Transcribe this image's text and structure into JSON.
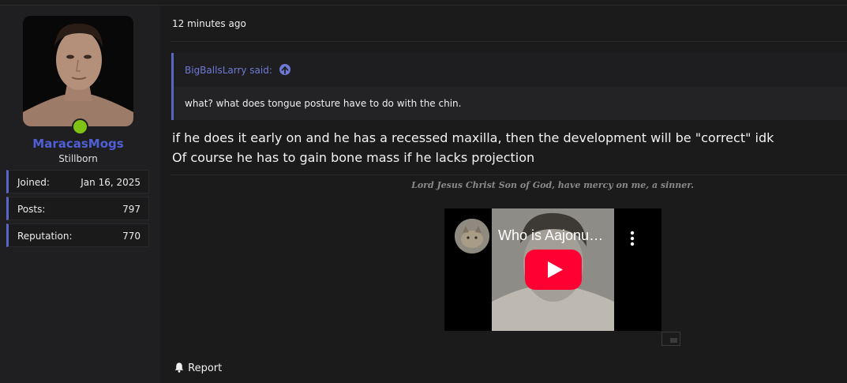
{
  "post": {
    "time": "12 minutes ago",
    "quote": {
      "author": "BigBallsLarry said:",
      "text": "what? what does tongue posture have to do with the chin."
    },
    "message": [
      "if he does it early on and he has a recessed maxilla, then the development will be \"correct\" idk",
      "Of course he has to gain bone mass if he lacks projection"
    ],
    "signature": "Lord Jesus Christ Son of God, have mercy on me, a sinner.",
    "report_label": "Report"
  },
  "user": {
    "name": "MaracasMogs",
    "title": "Stillborn",
    "online": true,
    "stats": [
      {
        "label": "Joined:",
        "value": "Jan 16, 2025"
      },
      {
        "label": "Posts:",
        "value": "797"
      },
      {
        "label": "Reputation:",
        "value": "770"
      }
    ]
  },
  "video": {
    "title": "Who is Aajonu…",
    "platform_icon": "youtube-play-icon"
  },
  "colors": {
    "accent": "#5b64c7",
    "username": "#4f5fd6",
    "online": "#7fc316",
    "youtube_red": "#ff0033"
  }
}
